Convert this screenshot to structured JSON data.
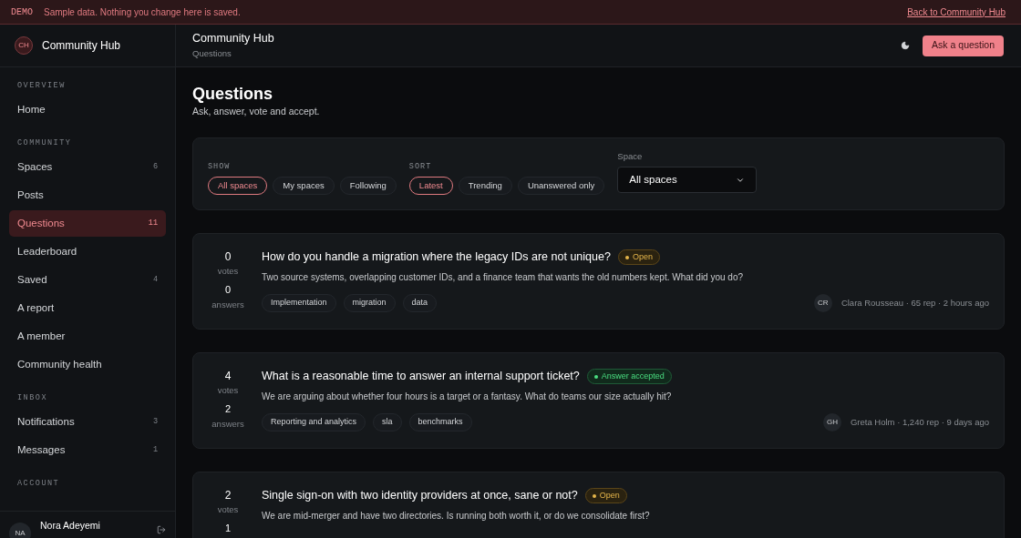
{
  "banner": {
    "tag": "DEMO",
    "message": "Sample data. Nothing you change here is saved.",
    "link": "Back to Community Hub"
  },
  "brand": {
    "initials": "CH",
    "name": "Community Hub"
  },
  "sidebar": {
    "sections": [
      {
        "title": "OVERVIEW",
        "items": [
          {
            "label": "Home",
            "selected": false
          }
        ]
      },
      {
        "title": "COMMUNITY",
        "items": [
          {
            "label": "Spaces",
            "count": "6",
            "selected": false
          },
          {
            "label": "Posts",
            "selected": false
          },
          {
            "label": "Questions",
            "count": "11",
            "selected": true
          },
          {
            "label": "Leaderboard",
            "selected": false
          },
          {
            "label": "Saved",
            "count": "4",
            "selected": false
          },
          {
            "label": "A report",
            "selected": false
          },
          {
            "label": "A member",
            "selected": false
          },
          {
            "label": "Community health",
            "selected": false
          }
        ]
      },
      {
        "title": "INBOX",
        "items": [
          {
            "label": "Notifications",
            "count": "3",
            "selected": false
          },
          {
            "label": "Messages",
            "count": "1",
            "selected": false
          }
        ]
      },
      {
        "title": "ACCOUNT"
      }
    ],
    "user": {
      "initials": "NA",
      "name": "Nora Adeyemi"
    }
  },
  "header": {
    "title": "Community Hub",
    "breadcrumb": "Questions",
    "button": "Ask a question"
  },
  "page": {
    "title": "Questions",
    "subtitle": "Ask, answer, vote and accept."
  },
  "filters": {
    "show": {
      "label": "SHOW",
      "options": [
        {
          "label": "All spaces",
          "selected": true
        },
        {
          "label": "My spaces",
          "selected": false
        },
        {
          "label": "Following",
          "selected": false
        }
      ]
    },
    "sort": {
      "label": "SORT",
      "options": [
        {
          "label": "Latest",
          "selected": true
        },
        {
          "label": "Trending",
          "selected": false
        },
        {
          "label": "Unanswered only",
          "selected": false
        }
      ]
    },
    "space": {
      "label": "Space",
      "value": "All spaces"
    }
  },
  "questions": [
    {
      "votes": "0",
      "votes_label": "votes",
      "answers": "0",
      "answers_label": "answers",
      "title": "How do you handle a migration where the legacy IDs are not unique?",
      "status": {
        "kind": "open",
        "label": "Open"
      },
      "body": "Two source systems, overlapping customer IDs, and a finance team that wants the old numbers kept. What did you do?",
      "tags": [
        "Implementation",
        "migration",
        "data"
      ],
      "author_initials": "CR",
      "author": "Clara Rousseau · 65 rep · 2 hours ago"
    },
    {
      "votes": "4",
      "votes_label": "votes",
      "answers": "2",
      "answers_label": "answers",
      "title": "What is a reasonable time to answer an internal support ticket?",
      "status": {
        "kind": "accepted",
        "label": "Answer accepted"
      },
      "body": "We are arguing about whether four hours is a target or a fantasy. What do teams our size actually hit?",
      "tags": [
        "Reporting and analytics",
        "sla",
        "benchmarks"
      ],
      "author_initials": "GH",
      "author": "Greta Holm · 1,240 rep · 9 days ago"
    },
    {
      "votes": "2",
      "votes_label": "votes",
      "answers": "1",
      "title": "Single sign-on with two identity providers at once, sane or not?",
      "status": {
        "kind": "open",
        "label": "Open"
      },
      "body": "We are mid-merger and have two directories. Is running both worth it, or do we consolidate first?"
    }
  ]
}
